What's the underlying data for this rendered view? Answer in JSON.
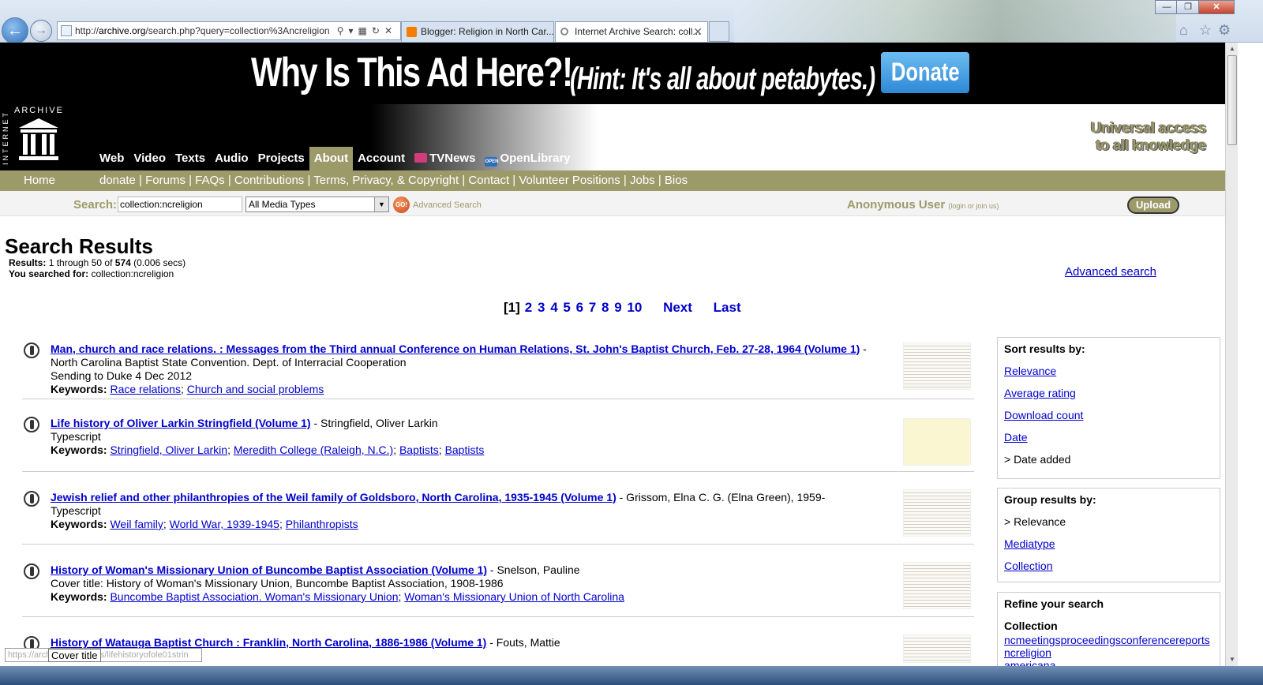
{
  "browser": {
    "url_prefix": "http://",
    "url_host": "archive.org",
    "url_rest": "/search.php?query=collection%3Ancreligion",
    "tabs": [
      {
        "label": "Blogger: Religion in North Car...",
        "active": false
      },
      {
        "label": "Internet Archive Search: coll...",
        "active": true
      }
    ],
    "window_controls": {
      "minimize": "—",
      "maximize": "❐",
      "close": "✕"
    }
  },
  "ad": {
    "headline": "Why Is This Ad Here?!",
    "hint": "(Hint: It's all about petabytes.)",
    "donate": "Donate"
  },
  "logo": {
    "vertical": "INTERNET",
    "top": "ARCHIVE"
  },
  "nav": {
    "items": [
      "Web",
      "Video",
      "Texts",
      "Audio",
      "Projects",
      "About",
      "Account",
      "TVNews",
      "OpenLibrary"
    ],
    "selected": "About"
  },
  "tagline": [
    "Universal access",
    "to all knowledge"
  ],
  "subnav": {
    "home": "Home",
    "links": "donate | Forums | FAQs | Contributions | Terms, Privacy, & Copyright | Contact | Volunteer Positions | Jobs | Bios"
  },
  "searchbar": {
    "label": "Search:",
    "query": "collection:ncreligion",
    "media_type": "All Media Types",
    "go": "GO!",
    "advanced": "Advanced Search",
    "user": "Anonymous User",
    "login": "(login or join us)",
    "upload": "Upload"
  },
  "page": {
    "title": "Search Results",
    "results_label": "Results:",
    "results_text": "1 through 50 of",
    "results_total": "574",
    "results_time": "(0.006 secs)",
    "searched_label": "You searched for:",
    "searched_value": "collection:ncreligion",
    "advanced_link": "Advanced search"
  },
  "pager": {
    "current": "[1]",
    "pages": [
      "2",
      "3",
      "4",
      "5",
      "6",
      "7",
      "8",
      "9",
      "10"
    ],
    "next": "Next",
    "last": "Last"
  },
  "results": [
    {
      "title": "Man, church and race relations. : Messages from the Third annual Conference on Human Relations, St. John's Baptist Church, Feb. 27-28, 1964 (Volume 1)",
      "creator": " - North Carolina Baptist State Convention. Dept. of Interracial Cooperation",
      "note": "Sending to Duke 4 Dec 2012",
      "keywords": [
        "Race relations",
        "Church and social problems"
      ]
    },
    {
      "title": "Life history of Oliver Larkin Stringfield (Volume 1)",
      "creator": " - Stringfield, Oliver Larkin",
      "note": "Typescript",
      "keywords": [
        "Stringfield, Oliver Larkin",
        "Meredith College (Raleigh, N.C.)",
        "Baptists",
        "Baptists"
      ]
    },
    {
      "title": "Jewish relief and other philanthropies of the Weil family of Goldsboro, North Carolina, 1935-1945 (Volume 1)",
      "creator": " - Grissom, Elna C. G. (Elna Green), 1959-",
      "note": "Typescript",
      "keywords": [
        "Weil family",
        "World War, 1939-1945",
        "Philanthropists"
      ]
    },
    {
      "title": "History of Woman's Missionary Union of Buncombe Baptist Association (Volume 1)",
      "creator": " - Snelson, Pauline",
      "note": "Cover title: History of Woman's Missionary Union, Buncombe Baptist Association, 1908-1986",
      "keywords": [
        "Buncombe Baptist Association. Woman's Missionary Union",
        "Woman's Missionary Union of North Carolina"
      ]
    },
    {
      "title": "History of Watauga Baptist Church : Franklin, North Carolina, 1886-1986 (Volume 1)",
      "creator": " - Fouts, Mattie",
      "note": "",
      "keywords": []
    }
  ],
  "keywords_label": "Keywords:",
  "sidebar": {
    "sort_title": "Sort results by:",
    "sort_items": [
      "Relevance",
      "Average rating",
      "Download count",
      "Date"
    ],
    "sort_current": "> Date added",
    "group_title": "Group results by:",
    "group_current": "> Relevance",
    "group_items": [
      "Mediatype",
      "Collection"
    ],
    "refine_title": "Refine your search",
    "collection_label": "Collection",
    "collections": [
      "ncmeetingsproceedingsconferencereports",
      "ncreligion",
      "americana"
    ]
  },
  "status": {
    "url": "https://archive.org/details/lifehistoryofole01strin",
    "tooltip": "Cover title"
  }
}
